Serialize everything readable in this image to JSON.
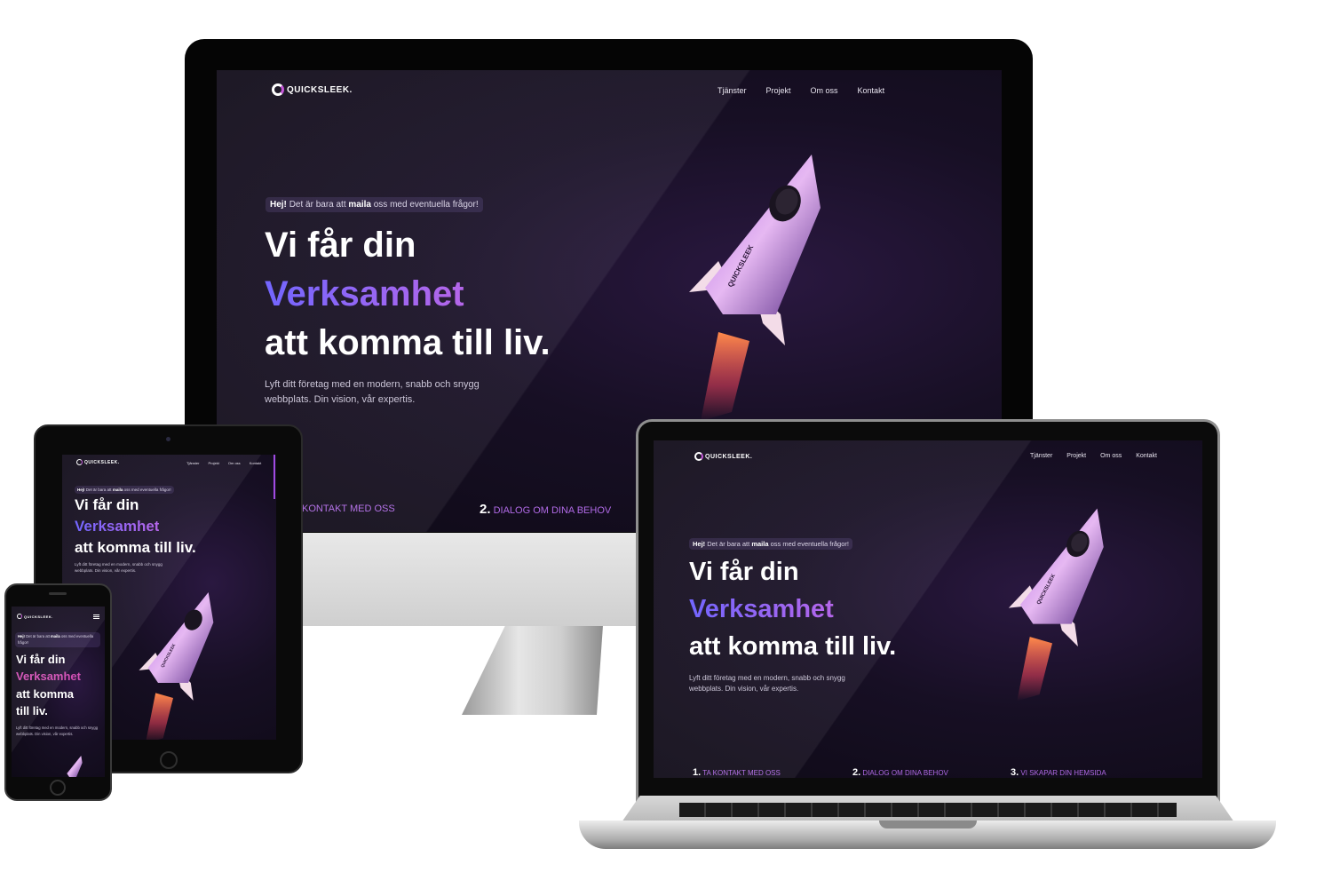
{
  "site": {
    "logo_text": "QUICKSLEEK.",
    "logo_text_phone": "QUICKSLEEK.",
    "nav": [
      "Tjänster",
      "Projekt",
      "Om oss",
      "Kontakt"
    ],
    "notice_hey": "Hej!",
    "notice_pre": "Det är bara att",
    "notice_bold": "maila",
    "notice_post": "oss med eventuella frågor!",
    "headline_1": "Vi får din",
    "headline_2": "Verksamhet",
    "headline_3": "att komma till liv.",
    "headline_3_phone_a": "att komma",
    "headline_3_phone_b": "till liv.",
    "lead_1": "Lyft ditt företag med en modern, snabb och snygg",
    "lead_2": "webbplats. Din vision, vår expertis.",
    "rocket_label": "QUICKSLEEK",
    "steps": [
      {
        "num": "1.",
        "label": "TA KONTAKT MED OSS"
      },
      {
        "num": "2.",
        "label": "DIALOG OM DINA BEHOV"
      },
      {
        "num": "3.",
        "label": "VI SKAPAR DIN HEMSIDA"
      }
    ],
    "desktop_step_1_partial": "KONTAKT MED OSS"
  },
  "colors": {
    "accent_purple": "#6a5cff",
    "accent_violet": "#b05ce8",
    "accent_pink": "#d24fb5",
    "bg_dark": "#170f24"
  },
  "icons": [
    "rocket-illustration",
    "hamburger-menu-icon",
    "camera-icon",
    "home-button-icon"
  ]
}
